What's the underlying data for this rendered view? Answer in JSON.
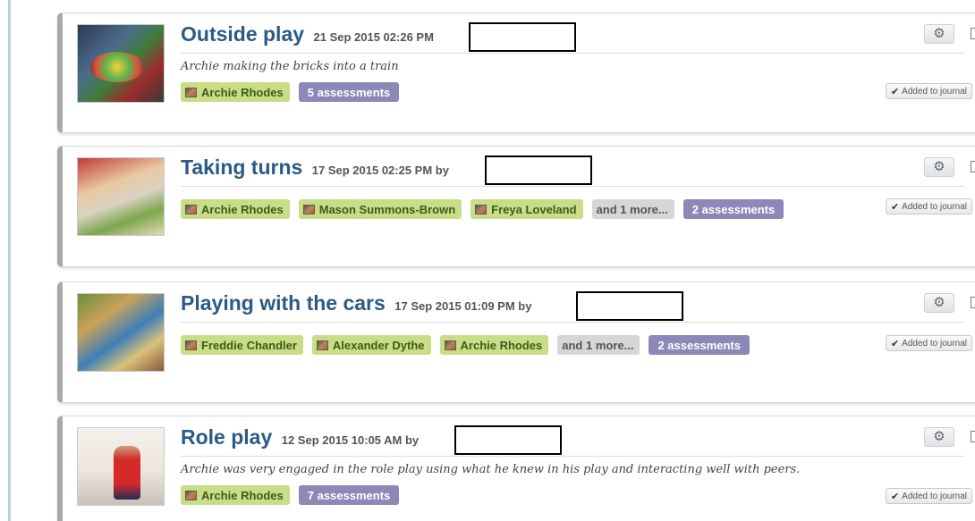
{
  "colors": {
    "title": "#2b5a86",
    "child_tag": "#c9dd86",
    "more_tag": "#d6d6d6",
    "assessment_tag": "#8c88b8"
  },
  "icons": {
    "settings": "gear-icon",
    "child": "child-photo-icon",
    "check": "check-icon"
  },
  "observations": [
    {
      "title": "Outside play",
      "meta": "21 Sep 2015 02:26 PM",
      "description": "Archie making the bricks into a train",
      "children": [
        "Archie Rhodes"
      ],
      "more": "",
      "assessments": "5 assessments",
      "journal": "Added to journal"
    },
    {
      "title": "Taking turns",
      "meta": "17 Sep 2015 02:25 PM by",
      "description": "",
      "children": [
        "Archie Rhodes",
        "Mason Summons-Brown",
        "Freya Loveland"
      ],
      "more": "and 1 more...",
      "assessments": "2 assessments",
      "journal": "Added to journal"
    },
    {
      "title": "Playing with the cars",
      "meta": "17 Sep 2015 01:09 PM by",
      "description": "",
      "children": [
        "Freddie Chandler",
        "Alexander Dythe",
        "Archie Rhodes"
      ],
      "more": "and 1 more...",
      "assessments": "2 assessments",
      "journal": "Added to journal"
    },
    {
      "title": "Role play",
      "meta": "12 Sep 2015 10:05 AM by",
      "description": "Archie was very engaged in the role play using what he knew in his play and interacting well with peers.",
      "children": [
        "Archie Rhodes"
      ],
      "more": "",
      "assessments": "7 assessments",
      "journal": "Added to journal"
    }
  ]
}
